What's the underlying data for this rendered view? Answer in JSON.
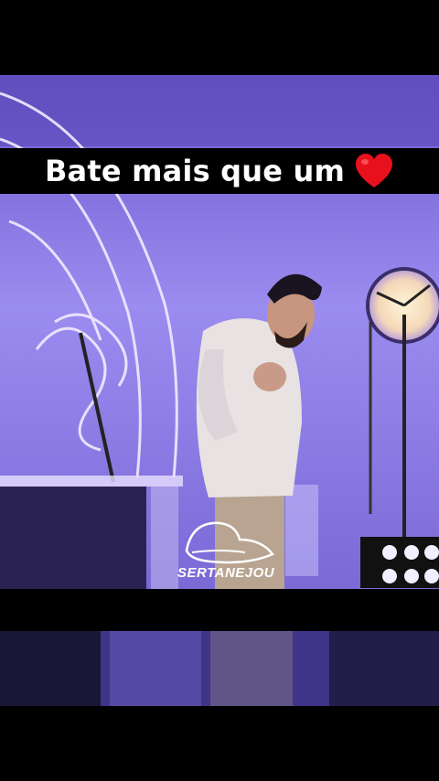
{
  "caption": {
    "text": "Bate mais que um",
    "emoji": "heart-icon"
  },
  "watermark": {
    "text": "SERTANEJOU"
  },
  "colors": {
    "stage_purple": "#8a78e0",
    "heart_red": "#e8101c",
    "caption_bg": "#000000"
  }
}
